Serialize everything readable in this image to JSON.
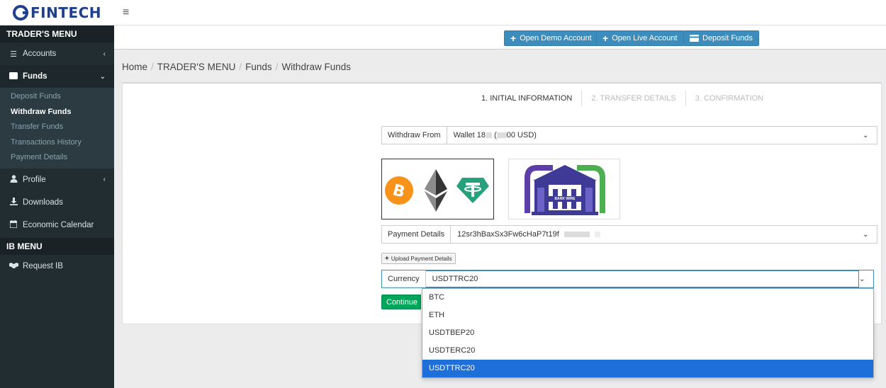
{
  "brand": {
    "logo_text": "FINTECH"
  },
  "topbar": {
    "menu_icon": "≡"
  },
  "sidebar": {
    "traders_header": "TRADER'S MENU",
    "items": [
      {
        "label": "Accounts",
        "icon": "list-icon"
      },
      {
        "label": "Funds",
        "icon": "wallet-icon"
      },
      {
        "label": "Profile",
        "icon": "user-icon"
      },
      {
        "label": "Downloads",
        "icon": "download-icon"
      },
      {
        "label": "Economic Calendar",
        "icon": "calendar-icon"
      }
    ],
    "funds_submenu": [
      "Deposit Funds",
      "Withdraw Funds",
      "Transfer Funds",
      "Transactions History",
      "Payment Details"
    ],
    "ib_header": "IB MENU",
    "ib_items": [
      {
        "label": "Request IB",
        "icon": "handshake-icon"
      }
    ]
  },
  "actions": {
    "open_demo": "Open Demo Account",
    "open_live": "Open Live Account",
    "deposit": "Deposit Funds"
  },
  "breadcrumb": [
    "Home",
    "TRADER'S MENU",
    "Funds",
    "Withdraw Funds"
  ],
  "steps": [
    "1. INITIAL INFORMATION",
    "2. TRANSFER DETAILS",
    "3. CONFIRMATION"
  ],
  "form": {
    "withdraw_from_label": "Withdraw From",
    "withdraw_from_prefix": "Wallet 18",
    "withdraw_from_suffix": "00 USD)",
    "withdraw_from_paren": "(",
    "payment_methods": {
      "bank_label": "BANK WIRE"
    },
    "payment_details_label": "Payment Details",
    "payment_details_value": "12sr3hBaxSx3Fw6cHaP7t19f",
    "upload_label": "Upload Payment Details",
    "currency_label": "Currency",
    "currency_value": "USDTTRC20",
    "continue_label": "Continue"
  },
  "currency_options": [
    "BTC",
    "ETH",
    "USDTBEP20",
    "USDTERC20",
    "USDTTRC20"
  ],
  "colors": {
    "sidebar_bg": "#222d32",
    "primary": "#3c8dbc",
    "success": "#00a65a",
    "selected_option": "#1e6fd9",
    "bitcoin": "#f7931a",
    "tether": "#26a17b",
    "bank": "#3f3a96"
  }
}
